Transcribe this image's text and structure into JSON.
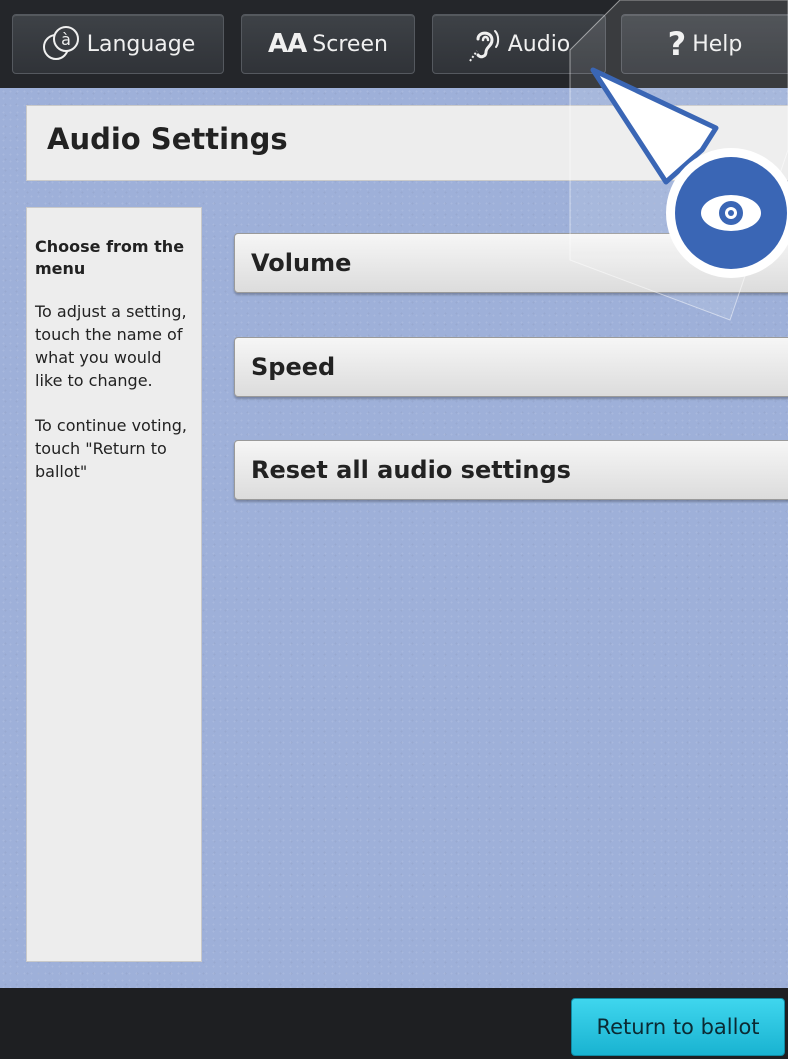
{
  "topbar": {
    "buttons": [
      {
        "label": "Language",
        "icon": "language-icon"
      },
      {
        "label": "Screen",
        "icon_text": "AA",
        "icon": "text-size-icon"
      },
      {
        "label": "Audio",
        "icon": "hearing-icon"
      },
      {
        "label": "Help",
        "icon_text": "?",
        "icon": "help-icon"
      }
    ],
    "language_glyph": "à"
  },
  "page": {
    "title": "Audio Settings"
  },
  "sidebar": {
    "heading": "Choose from the menu",
    "paragraphs": [
      "To adjust a setting, touch the name of what you would like to change.",
      "To continue voting, touch \"Return to ballot\""
    ]
  },
  "menu": {
    "items": [
      "Volume",
      "Speed",
      "Reset all audio settings"
    ]
  },
  "footer": {
    "return_label": "Return to ballot"
  },
  "callout": {
    "icon": "eye-icon",
    "accent": "#3a66b5"
  }
}
